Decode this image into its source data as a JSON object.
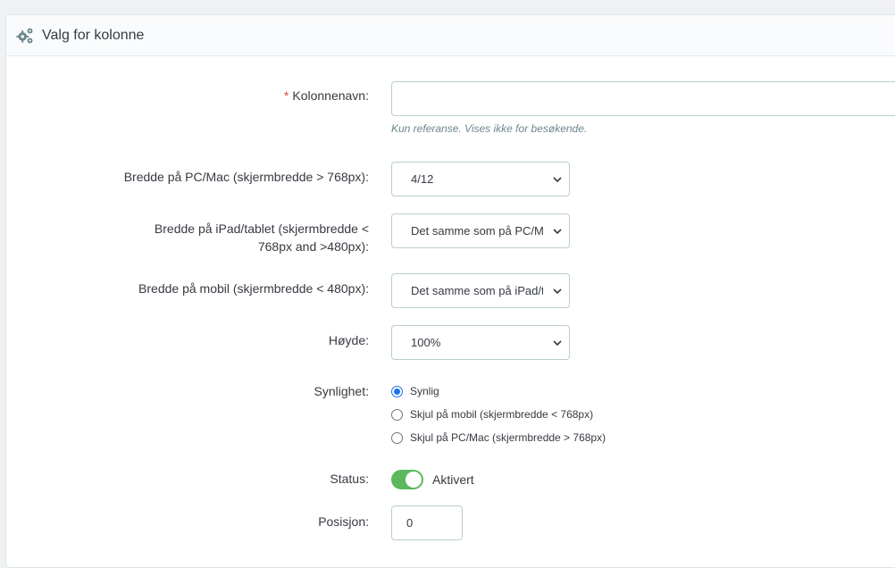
{
  "panel": {
    "title": "Valg for kolonne",
    "icon": "gears-icon"
  },
  "form": {
    "name": {
      "label": "Kolonnenavn:",
      "required_mark": "*",
      "value": "",
      "help": "Kun referanse. Vises ikke for besøkende."
    },
    "width_pc": {
      "label": "Bredde på PC/Mac (skjermbredde > 768px):",
      "value": "4/12"
    },
    "width_tablet": {
      "label_line1": "Bredde på iPad/tablet (skjermbredde <",
      "label_line2": "768px and >480px):",
      "value": "Det samme som på PC/Mac"
    },
    "width_mobile": {
      "label": "Bredde på mobil (skjermbredde < 480px):",
      "value": "Det samme som på iPad/tablet"
    },
    "height": {
      "label": "Høyde:",
      "value": "100%"
    },
    "visibility": {
      "label": "Synlighet:",
      "options": [
        "Synlig",
        "Skjul på mobil (skjermbredde < 768px)",
        "Skjul på PC/Mac (skjermbredde > 768px)"
      ],
      "selected": "Synlig"
    },
    "status": {
      "label": "Status:",
      "value": "Aktivert",
      "enabled": true,
      "color": "#5cb85c"
    },
    "position": {
      "label": "Posisjon:",
      "value": "0"
    }
  }
}
